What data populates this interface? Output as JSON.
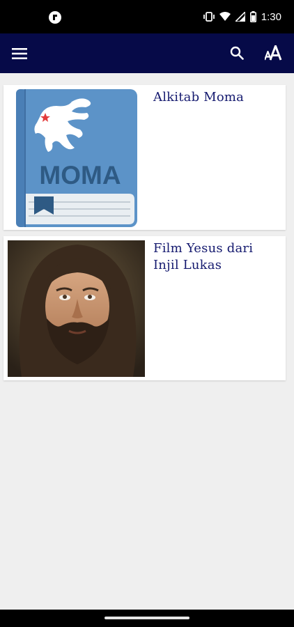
{
  "status_bar": {
    "time": "1:30",
    "icons": [
      "app-notification-icon",
      "vibrate-icon",
      "wifi-icon",
      "signal-icon",
      "battery-icon"
    ]
  },
  "app_bar": {
    "background": "#060a48",
    "icons": [
      "menu-icon",
      "search-icon",
      "font-size-icon"
    ]
  },
  "items": [
    {
      "title": "Alkitab Moma",
      "logo_text": "MOMA",
      "thumbnail": "moma-bible-book-image"
    },
    {
      "title": "Film Yesus dari Injil Lukas",
      "thumbnail": "jesus-film-portrait"
    }
  ],
  "colors": {
    "title": "#151a6f",
    "book_blue": "#5c93c8",
    "list_background": "#efefef"
  }
}
